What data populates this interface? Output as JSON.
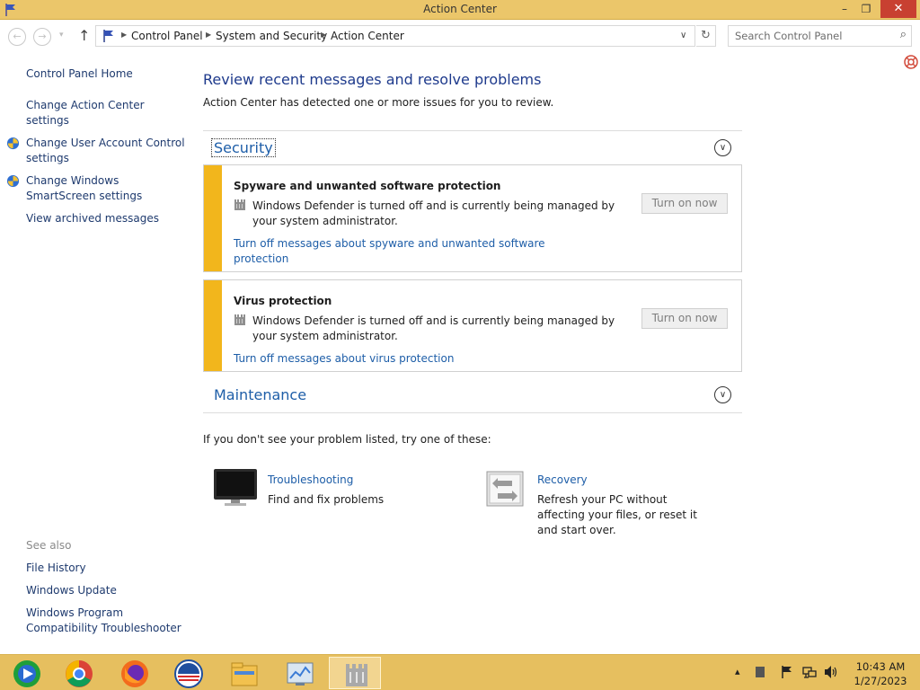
{
  "window": {
    "title": "Action Center",
    "minimize_glyph": "–",
    "maximize_glyph": "❐",
    "close_glyph": "✕"
  },
  "navigation": {
    "back_glyph": "←",
    "forward_glyph": "→",
    "recent_glyph": "▾",
    "up_glyph": "↑",
    "breadcrumbs": [
      "Control Panel",
      "System and Security",
      "Action Center"
    ],
    "separator_glyph": "▶",
    "dropdown_glyph": "∨",
    "refresh_glyph": "↻",
    "search_placeholder": "Search Control Panel",
    "search_icon_glyph": "⌕"
  },
  "sidebar": {
    "home": "Control Panel Home",
    "links": [
      {
        "label": "Change Action Center settings",
        "shield": false
      },
      {
        "label": "Change User Account Control settings",
        "shield": true
      },
      {
        "label": "Change Windows SmartScreen settings",
        "shield": true
      },
      {
        "label": "View archived messages",
        "shield": false
      }
    ],
    "see_also_heading": "See also",
    "see_also": [
      "File History",
      "Windows Update",
      "Windows Program Compatibility Troubleshooter"
    ]
  },
  "main": {
    "heading": "Review recent messages and resolve problems",
    "subheading": "Action Center has detected one or more issues for you to review.",
    "sections": [
      {
        "title": "Security",
        "expanded": true,
        "items": [
          {
            "title": "Spyware and unwanted software protection",
            "message": "Windows Defender is turned off and is currently being managed by your system administrator.",
            "link": "Turn off messages about spyware and unwanted software protection",
            "button": "Turn on now"
          },
          {
            "title": "Virus protection",
            "message": "Windows Defender is turned off and is currently being managed by your system administrator.",
            "link": "Turn off messages about virus protection",
            "button": "Turn on now"
          }
        ]
      },
      {
        "title": "Maintenance",
        "expanded": false
      }
    ],
    "try_text": "If you don't see your problem listed, try one of these:",
    "tools": [
      {
        "name": "Troubleshooting",
        "description": "Find and fix problems",
        "icon": "monitor-icon"
      },
      {
        "name": "Recovery",
        "description": "Refresh your PC without affecting your files, or reset it and start over.",
        "icon": "recovery-icon"
      }
    ],
    "chevron_glyph": "∨"
  },
  "taskbar": {
    "apps": [
      "windows-media-center-icon",
      "chrome-icon",
      "firefox-icon",
      "obama-logo-icon",
      "file-explorer-icon",
      "control-panel-icon",
      "action-center-icon"
    ],
    "active_app": "action-center-icon",
    "tray": {
      "show_hidden_glyph": "▴",
      "time": "10:43 AM",
      "date": "1/27/2023"
    }
  },
  "colors": {
    "titlebar": "#ebc66a",
    "taskbar": "#e6bf5f",
    "close_button": "#c84031",
    "link": "#1e5ea8",
    "heading": "#1e3a8c",
    "warning_stripe": "#f2b61c"
  }
}
